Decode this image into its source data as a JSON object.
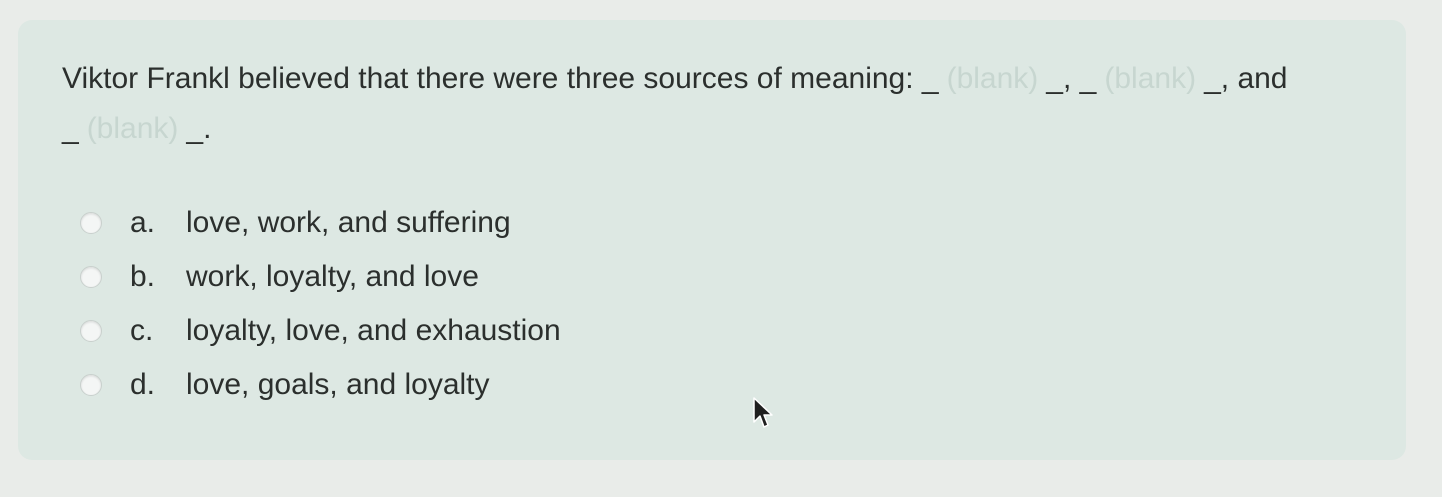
{
  "question": {
    "text": "Viktor Frankl believed that there were three sources of meaning:",
    "blank_placeholder": "(blank)",
    "blank_marker": "_",
    "separator_1": "_,",
    "separator_2": "_,",
    "and_text": "and",
    "end_marker": "_."
  },
  "options": [
    {
      "letter": "a.",
      "label": "love, work, and suffering"
    },
    {
      "letter": "b.",
      "label": "work, loyalty, and love"
    },
    {
      "letter": "c.",
      "label": "loyalty, love, and exhaustion"
    },
    {
      "letter": "d.",
      "label": "love, goals, and loyalty"
    }
  ],
  "icons": {
    "radio": "radio-circle",
    "cursor": "mouse-pointer-icon"
  },
  "colors": {
    "card_background": "#dde8e3",
    "page_background": "#e9ece9",
    "text": "#2b2f2d",
    "blank_placeholder": "#c7d6d0"
  }
}
